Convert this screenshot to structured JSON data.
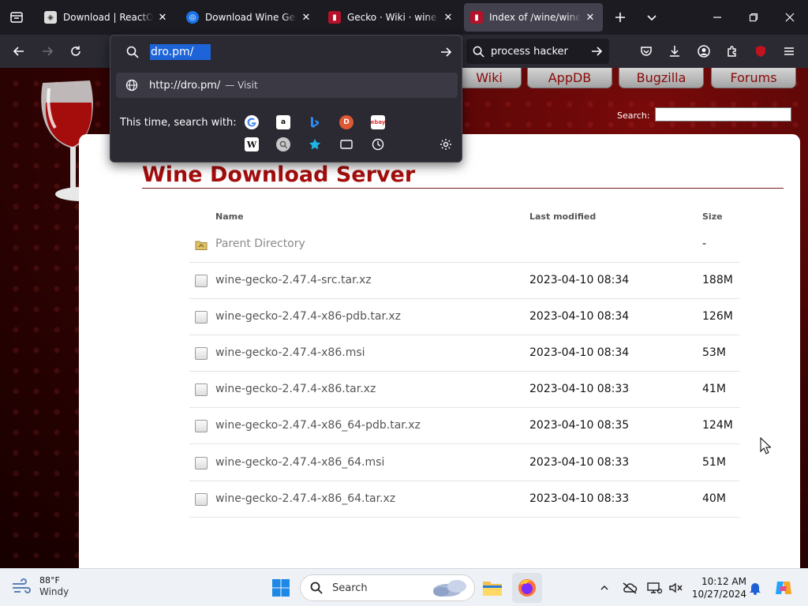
{
  "browser": {
    "tabs": [
      {
        "label": "Download | ReactOS Project",
        "active": false
      },
      {
        "label": "Download Wine Gecko",
        "active": false
      },
      {
        "label": "Gecko · Wiki · wine / wine",
        "active": false
      },
      {
        "label": "Index of /wine/wine-gecko",
        "active": true
      }
    ],
    "close_glyph": "✕",
    "url_value": "dro.pm/",
    "search_box_text": "process hacker",
    "accent": "#1c64d8"
  },
  "url_dropdown": {
    "suggestion_url": "http://dro.pm/",
    "suggestion_action": "— Visit",
    "search_with_label": "This time, search with:"
  },
  "site": {
    "nav_tabs": [
      "Wiki",
      "AppDB",
      "Bugzilla",
      "Forums"
    ],
    "search_label": "Search:",
    "title": "Wine Download Server",
    "title_color": "#a50d0d",
    "columns": {
      "name": "Name",
      "modified": "Last modified",
      "size": "Size"
    },
    "parent": {
      "name": "Parent Directory",
      "size": "-"
    },
    "files": [
      {
        "name": "wine-gecko-2.47.4-src.tar.xz",
        "modified": "2023-04-10 08:34",
        "size": "188M"
      },
      {
        "name": "wine-gecko-2.47.4-x86-pdb.tar.xz",
        "modified": "2023-04-10 08:34",
        "size": "126M"
      },
      {
        "name": "wine-gecko-2.47.4-x86.msi",
        "modified": "2023-04-10 08:34",
        "size": "53M"
      },
      {
        "name": "wine-gecko-2.47.4-x86.tar.xz",
        "modified": "2023-04-10 08:33",
        "size": "41M"
      },
      {
        "name": "wine-gecko-2.47.4-x86_64-pdb.tar.xz",
        "modified": "2023-04-10 08:35",
        "size": "124M"
      },
      {
        "name": "wine-gecko-2.47.4-x86_64.msi",
        "modified": "2023-04-10 08:33",
        "size": "51M"
      },
      {
        "name": "wine-gecko-2.47.4-x86_64.tar.xz",
        "modified": "2023-04-10 08:33",
        "size": "40M"
      }
    ]
  },
  "taskbar": {
    "weather_temp": "88°F",
    "weather_desc": "Windy",
    "search_label": "Search",
    "time": "10:12 AM",
    "date": "10/27/2024"
  }
}
